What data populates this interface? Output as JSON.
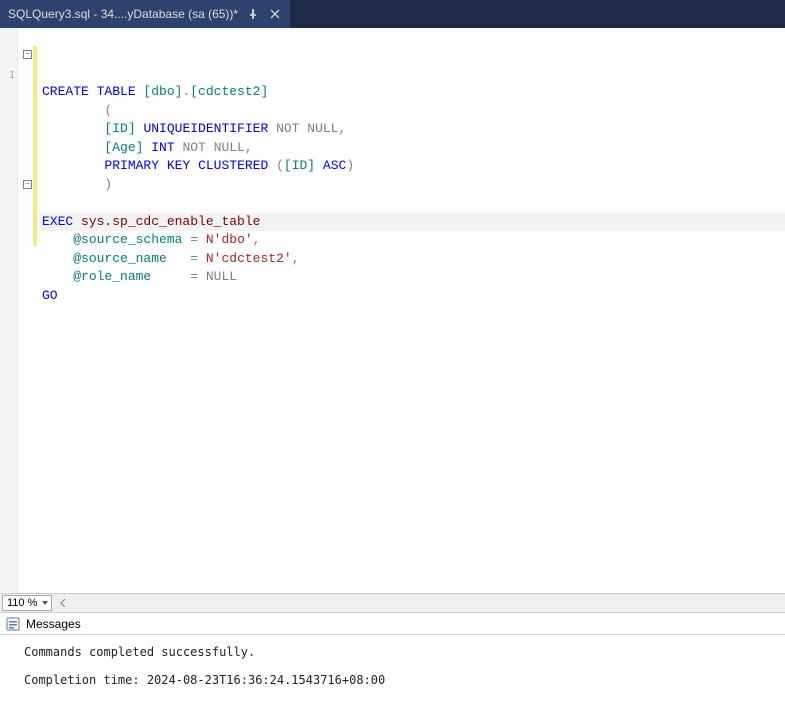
{
  "tab": {
    "title": "SQLQuery3.sql - 34....yDatabase (sa (65))*"
  },
  "left_strip": {
    "first_visible_line": "1"
  },
  "code": {
    "lines": [
      {
        "t": "plain",
        "parts": [
          {
            "c": "kw-blue",
            "v": "CREATE "
          },
          {
            "c": "kw-blue",
            "v": "TABLE "
          },
          {
            "c": "kw-teal",
            "v": "[dbo]"
          },
          {
            "c": "kw-gray",
            "v": "."
          },
          {
            "c": "kw-teal",
            "v": "[cdctest2]"
          }
        ]
      },
      {
        "t": "plain",
        "indent": 8,
        "parts": [
          {
            "c": "kw-gray",
            "v": "("
          }
        ]
      },
      {
        "t": "plain",
        "indent": 8,
        "parts": [
          {
            "c": "kw-teal",
            "v": "[ID] "
          },
          {
            "c": "kw-blue",
            "v": "UNIQUEIDENTIFIER "
          },
          {
            "c": "kw-gray",
            "v": "NOT NULL,"
          }
        ]
      },
      {
        "t": "plain",
        "indent": 8,
        "parts": [
          {
            "c": "kw-teal",
            "v": "[Age] "
          },
          {
            "c": "kw-blue",
            "v": "INT "
          },
          {
            "c": "kw-gray",
            "v": "NOT NULL,"
          }
        ]
      },
      {
        "t": "plain",
        "indent": 8,
        "parts": [
          {
            "c": "kw-blue",
            "v": "PRIMARY "
          },
          {
            "c": "kw-blue",
            "v": "KEY "
          },
          {
            "c": "kw-blue",
            "v": "CLUSTERED "
          },
          {
            "c": "kw-gray",
            "v": "("
          },
          {
            "c": "kw-teal",
            "v": "[ID]"
          },
          {
            "c": "kw-gray",
            "v": " "
          },
          {
            "c": "kw-blue",
            "v": "ASC"
          },
          {
            "c": "kw-gray",
            "v": ")"
          }
        ]
      },
      {
        "t": "plain",
        "indent": 8,
        "parts": [
          {
            "c": "kw-gray",
            "v": ")"
          }
        ]
      },
      {
        "t": "blank"
      },
      {
        "t": "plain",
        "parts": [
          {
            "c": "kw-blue",
            "v": "EXEC "
          },
          {
            "c": "kw-darkred",
            "v": "sys.sp_cdc_enable_table"
          }
        ]
      },
      {
        "t": "plain",
        "indent": 4,
        "parts": [
          {
            "c": "kw-teal",
            "v": "@source_schema "
          },
          {
            "c": "kw-gray",
            "v": "= "
          },
          {
            "c": "kw-red",
            "v": "N'dbo'"
          },
          {
            "c": "kw-gray",
            "v": ","
          }
        ]
      },
      {
        "t": "highlight",
        "indent": 4,
        "parts": [
          {
            "c": "kw-teal",
            "v": "@source_name   "
          },
          {
            "c": "kw-gray",
            "v": "= "
          },
          {
            "c": "kw-red",
            "v": "N'cdctest2'"
          },
          {
            "c": "kw-gray",
            "v": ","
          }
        ]
      },
      {
        "t": "plain",
        "indent": 4,
        "parts": [
          {
            "c": "kw-teal",
            "v": "@role_name     "
          },
          {
            "c": "kw-gray",
            "v": "= NULL"
          }
        ]
      },
      {
        "t": "plain",
        "parts": [
          {
            "c": "kw-blue",
            "v": "GO"
          }
        ]
      }
    ],
    "folds": [
      0,
      7
    ]
  },
  "zoom": {
    "value": "110 %"
  },
  "messages": {
    "tab_label": "Messages",
    "line1": "Commands completed successfully.",
    "line2": "Completion time: 2024-08-23T16:36:24.1543716+08:00"
  }
}
